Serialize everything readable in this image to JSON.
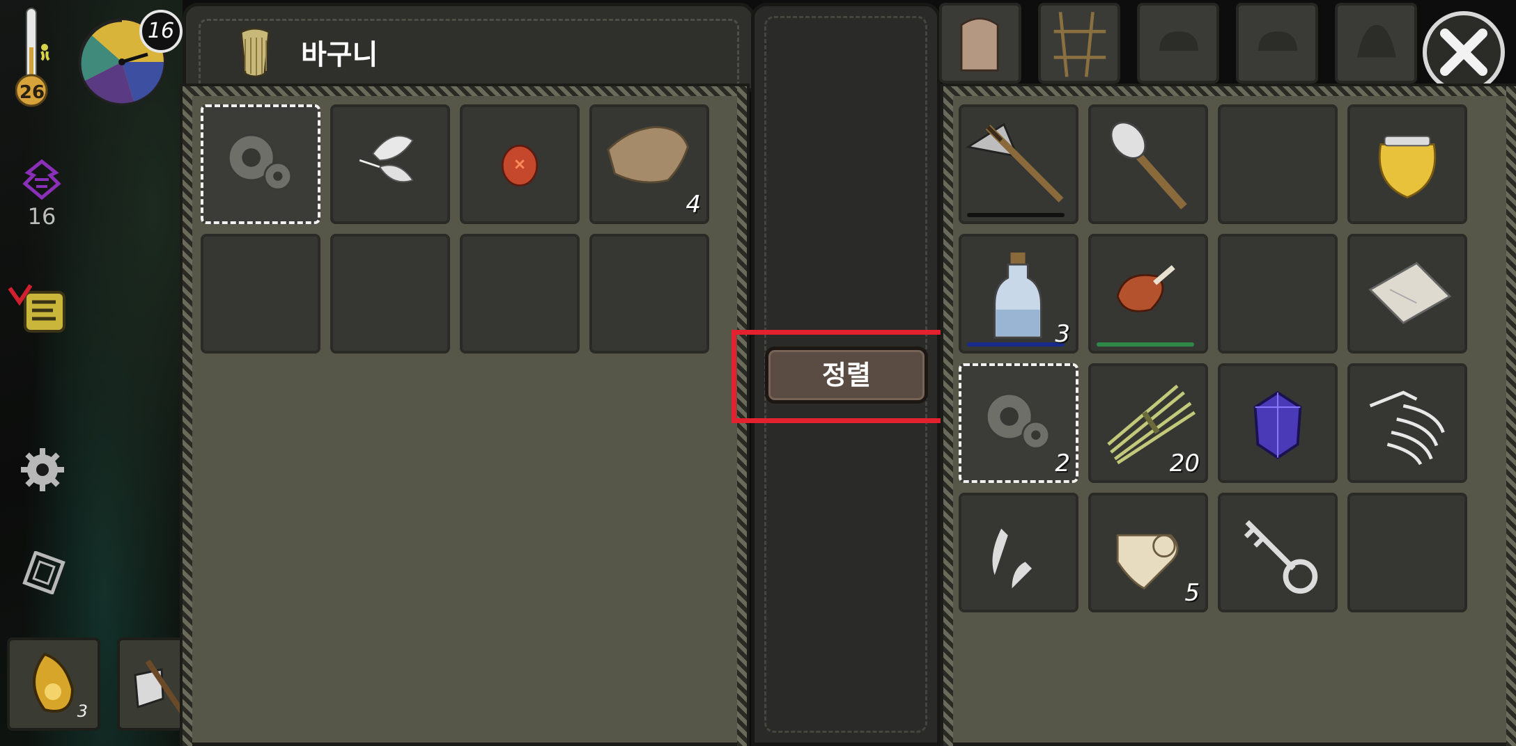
{
  "hud": {
    "temperature": "26",
    "day": "16",
    "sanity": "16",
    "quick_slot_count": "3"
  },
  "container": {
    "title": "바구니",
    "slots": [
      {
        "item": "gear-icon",
        "selected": true,
        "count": ""
      },
      {
        "item": "feather-icon",
        "selected": false,
        "count": ""
      },
      {
        "item": "red-seed-icon",
        "selected": false,
        "count": ""
      },
      {
        "item": "leather-scrap-icon",
        "selected": false,
        "count": "4"
      },
      {
        "item": "",
        "selected": false,
        "count": ""
      },
      {
        "item": "",
        "selected": false,
        "count": ""
      },
      {
        "item": "",
        "selected": false,
        "count": ""
      },
      {
        "item": "",
        "selected": false,
        "count": ""
      }
    ]
  },
  "sort_label": "정렬",
  "inventory": {
    "tabs": [
      "backpack-icon",
      "crafting-frame-icon",
      "helmet-icon",
      "helmet-icon",
      "armor-icon"
    ],
    "slots": [
      {
        "item": "stone-axe-icon",
        "count": "",
        "bar": "#111111"
      },
      {
        "item": "torch-icon",
        "count": "",
        "bar": ""
      },
      {
        "item": "",
        "count": "",
        "bar": ""
      },
      {
        "item": "honey-pot-icon",
        "count": "",
        "bar": ""
      },
      {
        "item": "water-bottle-icon",
        "count": "3",
        "bar": "#1a2a8a"
      },
      {
        "item": "meat-icon",
        "count": "",
        "bar": "#2f8a4a"
      },
      {
        "item": "",
        "count": "",
        "bar": ""
      },
      {
        "item": "cloth-icon",
        "count": "",
        "bar": ""
      },
      {
        "item": "gear-icon",
        "count": "2",
        "bar": "",
        "selected": true
      },
      {
        "item": "grass-bundle-icon",
        "count": "20",
        "bar": ""
      },
      {
        "item": "crystal-icon",
        "count": "",
        "bar": ""
      },
      {
        "item": "bird-skeleton-icon",
        "count": "",
        "bar": ""
      },
      {
        "item": "claw-icon",
        "count": "",
        "bar": ""
      },
      {
        "item": "scroll-icon",
        "count": "5",
        "bar": ""
      },
      {
        "item": "key-icon",
        "count": "",
        "bar": ""
      },
      {
        "item": "",
        "count": "",
        "bar": ""
      }
    ]
  }
}
